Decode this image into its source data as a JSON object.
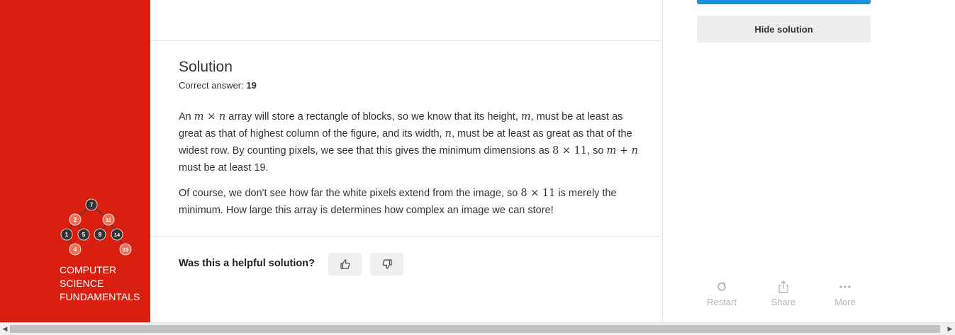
{
  "course": {
    "title_lines": [
      "COMPUTER",
      "SCIENCE",
      "FUNDAMENTALS"
    ],
    "tree_nodes": [
      "7",
      "2",
      "11",
      "1",
      "5",
      "8",
      "14",
      "4",
      "15"
    ]
  },
  "solution": {
    "heading": "Solution",
    "correct_answer_label": "Correct answer:",
    "correct_answer_value": "19",
    "p1": {
      "t1": "An ",
      "m1": "m",
      "times1": " × ",
      "n1": "n",
      "t2": " array will store a rectangle of blocks, so we know that its height, ",
      "m2": "m",
      "t3": ", must be at least as great as that of highest column of the figure, and its width, ",
      "n2": "n",
      "t4": ", must be at least as great as that of the widest row. By counting pixels, we see that this gives the minimum dimensions as ",
      "dim": "8 × 11",
      "t5": ", so ",
      "m3": "m",
      "plus": " + ",
      "n3": "n",
      "t6": " must be at least 19."
    },
    "p2": {
      "t1": "Of course, we don't see how far the white pixels extend from the image, so ",
      "dim": "8 × 11",
      "t2": " is merely the minimum. How large this array is determines how complex an image we can store!"
    },
    "helpful_question": "Was this a helpful solution?"
  },
  "sidebar_right": {
    "hide_solution_label": "Hide solution",
    "tools": {
      "restart": "Restart",
      "share": "Share",
      "more": "More"
    }
  },
  "colors": {
    "sidebar_red": "#d92010",
    "accent_blue": "#1a91da",
    "node_dark": "#333333",
    "node_salmon": "#f0705a"
  }
}
